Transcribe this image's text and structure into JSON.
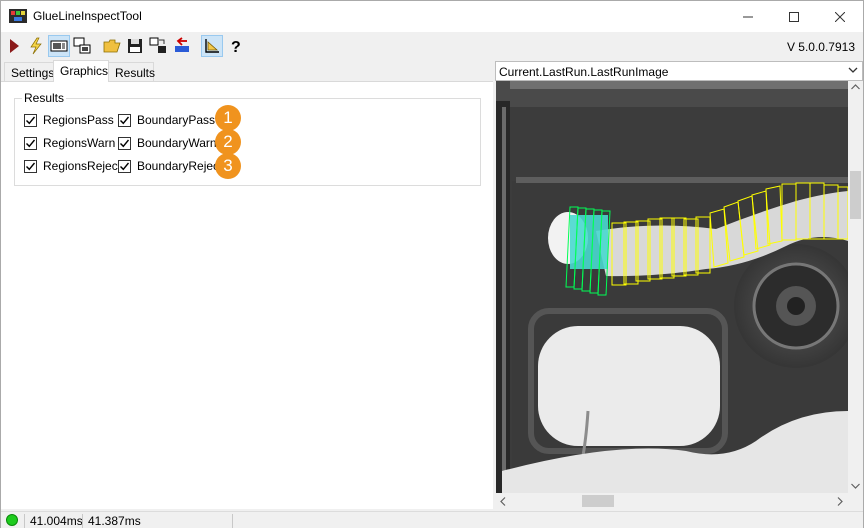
{
  "window": {
    "title": "GlueLineInspectTool"
  },
  "toolbar": {
    "items": [
      "run-icon",
      "lightning-icon",
      "show-panel-icon",
      "split-view-icon",
      "open-folder-icon",
      "save-icon",
      "import-export-icon",
      "reset-icon",
      "graphics-settings-icon",
      "help-icon"
    ],
    "version": "V 5.0.0.7913"
  },
  "tabs": [
    "Settings",
    "Graphics",
    "Results"
  ],
  "graphics": {
    "group_label": "Results",
    "checkboxes": [
      {
        "label": "RegionsPass",
        "checked": true
      },
      {
        "label": "BoundaryPass",
        "checked": true
      },
      {
        "label": "RegionsWarn",
        "checked": true
      },
      {
        "label": "BoundaryWarn",
        "checked": true
      },
      {
        "label": "RegionsReject",
        "checked": true
      },
      {
        "label": "BoundaryReject",
        "checked": true
      }
    ],
    "badges": [
      "1",
      "2",
      "3"
    ]
  },
  "image_pane": {
    "selected_image": "Current.LastRun.LastRunImage"
  },
  "status": {
    "time1": "41.004ms",
    "time2": "41.387ms"
  },
  "colors": {
    "badge": "#f0931e",
    "pass_region": "#ffff00",
    "warn_region": "#00ff7f",
    "status_ok": "#1ecb1e"
  }
}
